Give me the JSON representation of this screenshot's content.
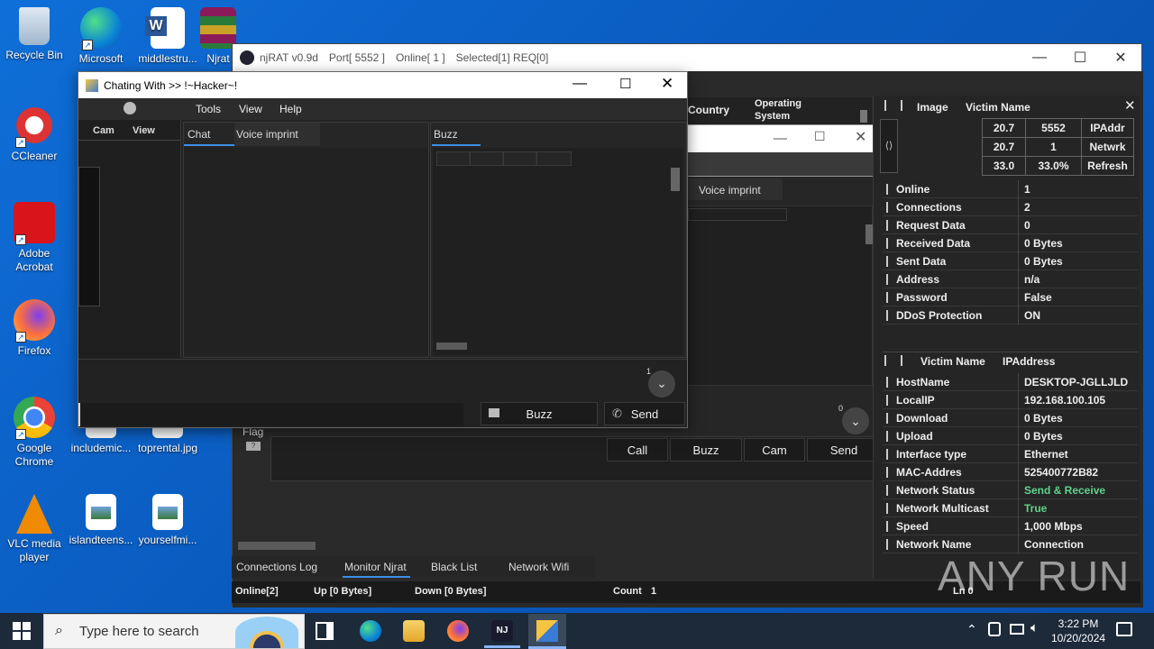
{
  "desktop": {
    "icons": [
      {
        "label": "Recycle Bin"
      },
      {
        "label": "Microsoft Edge"
      },
      {
        "label": "middlestru..."
      },
      {
        "label": "Njrat"
      },
      {
        "label": "CCleaner"
      },
      {
        "label": "Adobe Acrobat"
      },
      {
        "label": "Firefox"
      },
      {
        "label": "Google Chrome"
      },
      {
        "label": "includemic..."
      },
      {
        "label": "toprental.jpg"
      },
      {
        "label": "VLC media player"
      },
      {
        "label": "islandteens..."
      },
      {
        "label": "yourselfmi..."
      }
    ]
  },
  "njrat": {
    "title": "njRAT v0.9d",
    "port": "Port[ 5552 ]",
    "online": "Online[ 1 ]",
    "selected": "Selected[1] REQ[0]",
    "col_country": "Country",
    "col_os": "Operating System",
    "flag_label": "Flag",
    "stats": [
      [
        "20.7",
        "5552",
        "IPAddr"
      ],
      [
        "20.7",
        "1",
        "Netwrk"
      ],
      [
        "33.0",
        "33.0%",
        "Refresh"
      ]
    ],
    "header1": {
      "image": "Image",
      "victim": "Victim Name"
    },
    "header2": {
      "victim": "Victim Name",
      "ip": "IPAddress"
    },
    "info1": [
      {
        "k": "Online",
        "v": "1"
      },
      {
        "k": "Connections",
        "v": "2"
      },
      {
        "k": "Request Data",
        "v": "0"
      },
      {
        "k": "Received Data",
        "v": "0 Bytes"
      },
      {
        "k": "Sent Data",
        "v": "0 Bytes"
      },
      {
        "k": "Address",
        "v": "n/a"
      },
      {
        "k": "Password",
        "v": "False"
      },
      {
        "k": "DDoS Protection",
        "v": "ON"
      }
    ],
    "info2": [
      {
        "k": "HostName",
        "v": "DESKTOP-JGLLJLD"
      },
      {
        "k": "LocalIP",
        "v": "192.168.100.105"
      },
      {
        "k": "Download",
        "v": "0 Bytes"
      },
      {
        "k": "Upload",
        "v": "0 Bytes"
      },
      {
        "k": "Interface type",
        "v": "Ethernet"
      },
      {
        "k": "MAC-Addres",
        "v": "525400772B82"
      },
      {
        "k": "Network Status",
        "v": "Send & Receive"
      },
      {
        "k": "Network Multicast",
        "v": "True"
      },
      {
        "k": "Speed",
        "v": "1,000 Mbps"
      },
      {
        "k": "Network Name",
        "v": "Connection"
      }
    ],
    "bottom_tabs": [
      "Connections Log",
      "Monitor Njrat",
      "Black List",
      "Network Wifi"
    ],
    "status": {
      "online": "Online[2]",
      "up": "Up [0 Bytes]",
      "down": "Down [0 Bytes]",
      "count_label": "Count",
      "count": "1",
      "ln": "Ln 0"
    },
    "inner_tab": "Voice imprint",
    "inner_badge": "0",
    "inner_buttons": [
      "Call",
      "Buzz",
      "Cam",
      "Send"
    ],
    "accent_green": "#5fd38d"
  },
  "chat": {
    "title": "Chating With >> !~Hacker~!",
    "menu": [
      "Tools",
      "View",
      "Help"
    ],
    "left_menu": [
      "Cam",
      "View"
    ],
    "tabs": [
      "Chat",
      "Voice imprint"
    ],
    "buzz_tab": "Buzz",
    "badge": "1",
    "buzz_button": "Buzz",
    "send_button": "Send",
    "message_placeholder": ""
  },
  "taskbar": {
    "search_placeholder": "Type here to search",
    "time": "3:22 PM",
    "date": "10/20/2024"
  },
  "watermark": "ANY RUN"
}
